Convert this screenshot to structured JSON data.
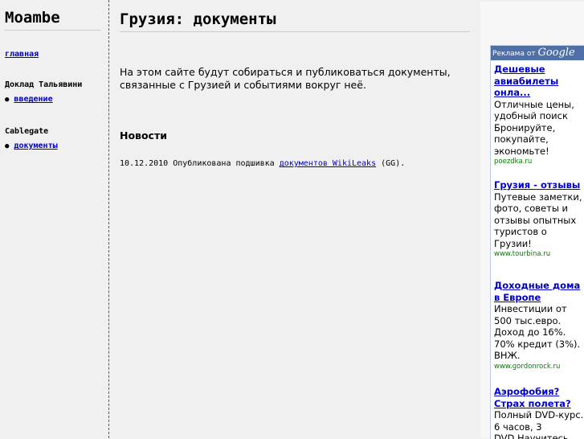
{
  "sidebar": {
    "site_title": "Moambe",
    "home_link": "главная",
    "section1": {
      "heading": "Доклад Тальявини",
      "items": [
        {
          "label": "введение"
        }
      ]
    },
    "section2": {
      "heading": "Cablegate",
      "items": [
        {
          "label": "документы"
        }
      ]
    },
    "bullet": "●"
  },
  "main": {
    "page_title": "Грузия: документы",
    "intro": "На этом сайте будут собираться и публиковаться документы, связанные с Грузией и событиями вокруг неё.",
    "news_heading": "Новости",
    "news": [
      {
        "prefix": "10.12.2010 Опубликована подшивка ",
        "link": "документов WikiLeaks",
        "suffix": " (GG)."
      }
    ]
  },
  "ads": {
    "bar_label": "Реклама от",
    "bar_brand": "Google",
    "items": [
      {
        "title": "Дешевые авиабилеты онла...",
        "body": "Отличные цены, удобный поиск Бронируйте, покупайте, экономьте!",
        "url": "poezdka.ru"
      },
      {
        "title": "Грузия - отзывы",
        "body": "Путевые заметки, фото, советы и отзывы опытных туристов о Грузии!",
        "url": "www.tourbina.ru"
      },
      {
        "title": "Доходные дома в Европе",
        "body": "Инвестиции от 500 тыс.евро. Доход до 16%. 70% кредит (3%). ВНЖ.",
        "url": "www.gordonrock.ru"
      },
      {
        "title": "Аэрофобия? Страх полета?",
        "body": "Полный DVD-курс. 6 часов, 3 DVD.Научитесь",
        "url": ""
      }
    ]
  },
  "colors": {
    "link": "#0000cc",
    "ad_bar": "#4f6fa8",
    "ad_url": "#008000",
    "background": "#f0f0f0"
  }
}
